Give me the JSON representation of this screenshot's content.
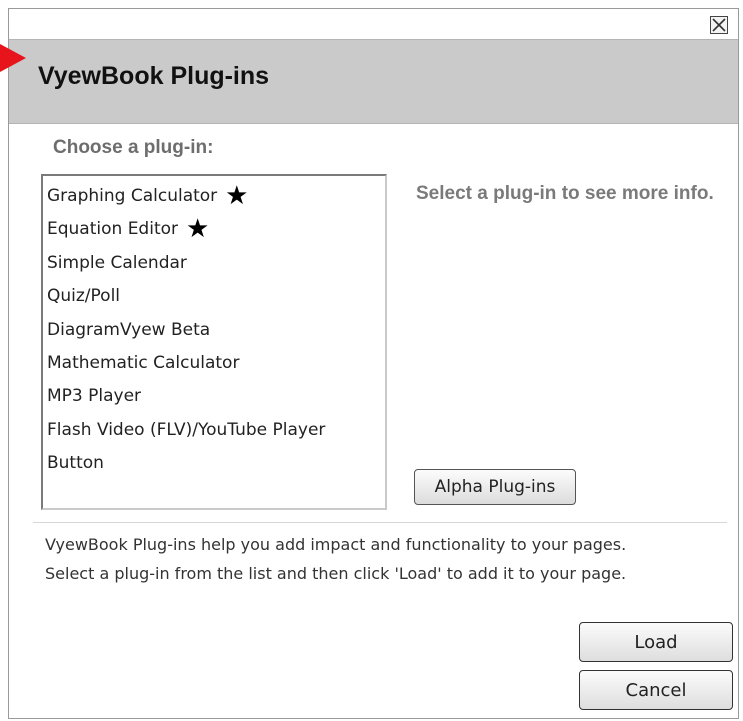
{
  "dialog": {
    "title": "VyewBook Plug-ins",
    "close_icon": "close-x-icon",
    "choose_label": "Choose a plug-in:",
    "info_text": "Select a plug-in to see more info.",
    "alpha_button": "Alpha Plug-ins",
    "description_lines": [
      "VyewBook Plug-ins help you add impact and functionality to your pages.",
      "Select a plug-in from the list and then click 'Load' to add it to your page."
    ],
    "load_button": "Load",
    "cancel_button": "Cancel",
    "arrow_color": "#e8141c"
  },
  "plugins": [
    {
      "label": "Graphing Calculator",
      "starred": true
    },
    {
      "label": "Equation Editor",
      "starred": true
    },
    {
      "label": "Simple Calendar",
      "starred": false
    },
    {
      "label": "Quiz/Poll",
      "starred": false
    },
    {
      "label": "DiagramVyew Beta",
      "starred": false
    },
    {
      "label": "Mathematic Calculator",
      "starred": false
    },
    {
      "label": "MP3 Player",
      "starred": false
    },
    {
      "label": "Flash Video (FLV)/YouTube Player",
      "starred": false
    },
    {
      "label": "Button",
      "starred": false
    }
  ]
}
